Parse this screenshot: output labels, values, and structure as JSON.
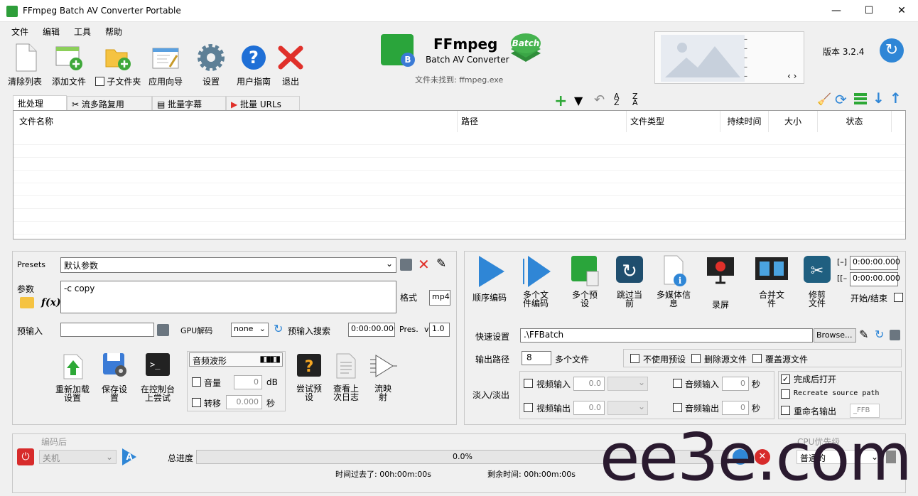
{
  "window": {
    "title": "FFmpeg Batch AV Converter Portable",
    "min": "—",
    "max": "☐",
    "close": "✕"
  },
  "menu": [
    "文件",
    "编辑",
    "工具",
    "帮助"
  ],
  "toolbar": {
    "clear": "清除列表",
    "add": "添加文件",
    "subfolder": "子文件夹",
    "wizard": "应用向导",
    "settings": "设置",
    "guide": "用户指南",
    "exit": "退出"
  },
  "logo": {
    "name": "FFmpeg",
    "sub": "Batch AV Converter",
    "badge": "Batch",
    "notfound": "文件未找到: ffmpeg.exe"
  },
  "version": "版本 3.2.4",
  "preview_nav": "‹ ›",
  "tabs": [
    "批处理",
    "流多路复用",
    "批量字幕",
    "批量 URLs"
  ],
  "columns": [
    "文件名称",
    "路径",
    "文件类型",
    "持续时间",
    "大小",
    "状态"
  ],
  "left": {
    "presets_label": "Presets",
    "presets_value": "默认参数",
    "params_label": "参数",
    "params_value": "-c copy",
    "format_label": "格式",
    "format_value": "mp4",
    "preinput_label": "预输入",
    "gpu_label": "GPU解码",
    "gpu_value": "none",
    "preinput_search": "预输入搜索",
    "time_value": "0:00:00.000",
    "pres_label": "Pres.",
    "pres_prefix": "v",
    "pres_value": "1.0",
    "btn_reload": "重新加载设置",
    "btn_save": "保存设置",
    "btn_console": "在控制台上尝试",
    "waveform": "音频波形",
    "volume": "音量",
    "volume_val": "0",
    "db": "dB",
    "shift": "转移",
    "shift_val": "0.000",
    "sec": "秒",
    "btn_try": "尝试预设",
    "btn_log": "查看上次日志",
    "btn_map": "流映射"
  },
  "right": {
    "b1": "顺序编码",
    "b2": "多个文件编码",
    "b3": "多个预设",
    "b4": "跳过当前",
    "b5": "多媒体信息",
    "b6": "录屏",
    "b7": "合并文件",
    "b8": "修剪文件",
    "start_label": "[–]",
    "end_label": "[[–",
    "start_val": "0:00:00.000",
    "end_val": "0:00:00.000",
    "startend": "开始/结束",
    "quick_label": "快速设置",
    "quick_value": ".\\FFBatch",
    "browse": "Browse...",
    "out_label": "输出路径",
    "out_num": "8",
    "multi": "多个文件",
    "nopreset": "不使用预设",
    "delsrc": "删除源文件",
    "overwrite": "覆盖源文件",
    "fade_label": "淡入/淡出",
    "vin": "视频输入",
    "vout": "视频输出",
    "ain": "音频输入",
    "aout": "音频输出",
    "vin_val": "0.0",
    "vout_val": "0.0",
    "ain_val": "0",
    "aout_val": "0",
    "sec": "秒",
    "open_done": "完成后打开",
    "recreate": "Recreate source path",
    "rename": "重命名输出",
    "rename_val": "_FFB"
  },
  "bottom": {
    "after_label": "编码后",
    "shutdown": "关机",
    "total_label": "总进度",
    "progress": 0.0,
    "progress_text": "0.0%",
    "elapsed": "时间过去了: 00h:00m:00s",
    "remaining": "剩余时间: 00h:00m:00s",
    "priority": "普通的",
    "priority_label": "CPU优先级"
  },
  "watermark": "ee3e.com"
}
